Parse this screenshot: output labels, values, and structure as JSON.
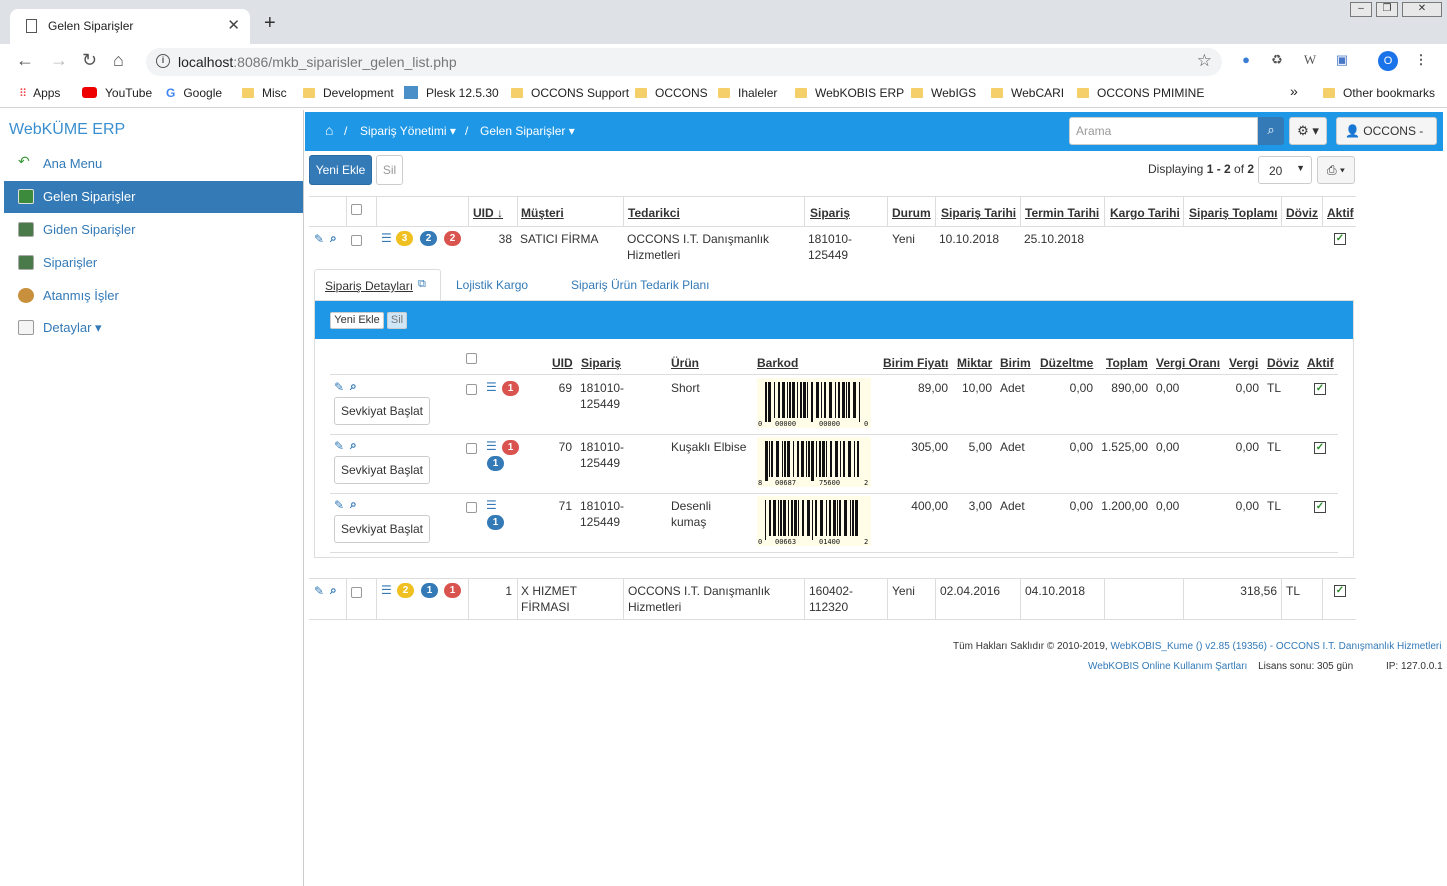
{
  "browser": {
    "tab_title": "Gelen Siparişler",
    "url_host": "localhost",
    "url_rest": ":8086/mkb_siparisler_gelen_list.php",
    "profile_initial": "O",
    "bookmarks": [
      "Apps",
      "YouTube",
      "Google",
      "Misc",
      "Development",
      "Plesk 12.5.30",
      "OCCONS Support",
      "OCCONS",
      "Ihaleler",
      "WebKOBIS ERP",
      "WebIGS",
      "WebCARI",
      "OCCONS PMIMINE"
    ],
    "other_bookmarks": "Other bookmarks",
    "overflow": "»"
  },
  "sidebar": {
    "brand": "WebKÜME ERP",
    "items": [
      {
        "label": "Ana Menu",
        "icon": "back-arrow-icon"
      },
      {
        "label": "Gelen Siparişler",
        "icon": "incoming-orders-icon"
      },
      {
        "label": "Giden Siparişler",
        "icon": "outgoing-orders-icon"
      },
      {
        "label": "Siparişler",
        "icon": "orders-icon"
      },
      {
        "label": "Atanmış İşler",
        "icon": "assigned-jobs-icon"
      },
      {
        "label": "Detaylar",
        "icon": "details-icon"
      }
    ]
  },
  "topbar": {
    "crumb1": "Sipariş Yönetimi",
    "crumb2": "Gelen Siparişler",
    "search_placeholder": "Arama",
    "user": "OCCONS -"
  },
  "list": {
    "new_label": "Yeni Ekle",
    "delete_label": "Sil",
    "display_prefix": "Displaying ",
    "display_range": "1 - 2",
    "display_of": " of ",
    "display_total": "2",
    "page_size": "20",
    "headers": [
      "UID",
      "Müşteri",
      "Tedarikci",
      "Sipariş",
      "Durum",
      "Sipariş Tarihi",
      "Termin Tarihi",
      "Kargo Tarihi",
      "Sipariş Toplamı",
      "Döviz",
      "Aktif"
    ],
    "rows": [
      {
        "badges": [
          "3",
          "2",
          "2"
        ],
        "uid": "38",
        "musteri": "SATICI FİRMA",
        "musteri2": "",
        "tedarikci": "OCCONS I.T. Danışmanlık",
        "tedarikci2": "Hizmetleri",
        "siparis": "181010-",
        "siparis2": "125449",
        "durum": "Yeni",
        "siparis_tarihi": "10.10.2018",
        "termin_tarihi": "25.10.2018",
        "kargo_tarihi": "",
        "toplam": "",
        "doviz": ""
      },
      {
        "badges": [
          "2",
          "1",
          "1"
        ],
        "uid": "1",
        "musteri": "X HIZMET",
        "musteri2": "FİRMASI",
        "tedarikci": "OCCONS I.T. Danışmanlık",
        "tedarikci2": "Hizmetleri",
        "siparis": "160402-",
        "siparis2": "112320",
        "durum": "Yeni",
        "siparis_tarihi": "02.04.2016",
        "termin_tarihi": "04.10.2018",
        "kargo_tarihi": "",
        "toplam": "318,56",
        "doviz": "TL"
      }
    ]
  },
  "detail": {
    "tabs": [
      "Sipariş Detayları",
      "Lojistik Kargo",
      "Sipariş Ürün Tedarik Planı"
    ],
    "new_label": "Yeni Ekle",
    "delete_label": "Sil",
    "headers": [
      "UID",
      "Sipariş",
      "Ürün",
      "Barkod",
      "Birim Fiyatı",
      "Miktar",
      "Birim",
      "Düzeltme",
      "Toplam",
      "Vergi Oranı",
      "Vergi",
      "Döviz",
      "Aktif"
    ],
    "ship_label": "Sevkiyat Başlat",
    "rows": [
      {
        "uid": "69",
        "siparis": "181010-",
        "siparis2": "125449",
        "urun": "Short",
        "urun2": "",
        "fiyat": "89,00",
        "miktar": "10,00",
        "birim": "Adet",
        "duzeltme": "0,00",
        "toplam": "890,00",
        "vergi_orani": "0,00",
        "vergi": "0,00",
        "doviz": "TL",
        "bc_left": "0",
        "bc_mid1": "00000",
        "bc_mid2": "00000",
        "bc_right": "0"
      },
      {
        "uid": "70",
        "siparis": "181010-",
        "siparis2": "125449",
        "urun": "Kuşaklı Elbise",
        "urun2": "",
        "fiyat": "305,00",
        "miktar": "5,00",
        "birim": "Adet",
        "duzeltme": "0,00",
        "toplam": "1.525,00",
        "vergi_orani": "0,00",
        "vergi": "0,00",
        "doviz": "TL",
        "bc_left": "8",
        "bc_mid1": "00687",
        "bc_mid2": "75600",
        "bc_right": "2"
      },
      {
        "uid": "71",
        "siparis": "181010-",
        "siparis2": "125449",
        "urun": "Desenli",
        "urun2": "kumaş",
        "fiyat": "400,00",
        "miktar": "3,00",
        "birim": "Adet",
        "duzeltme": "0,00",
        "toplam": "1.200,00",
        "vergi_orani": "0,00",
        "vergi": "0,00",
        "doviz": "TL",
        "bc_left": "0",
        "bc_mid1": "00663",
        "bc_mid2": "01400",
        "bc_right": "2"
      }
    ]
  },
  "footer": {
    "copyright": "Tüm Hakları Saklıdır © 2010-2019, ",
    "product": "WebKOBIS_Kume () v2.85 (19356)",
    "sep": " - ",
    "company": "OCCONS I.T. Danışmanlık Hizmetleri",
    "terms": "WebKOBIS Online Kullanım Şartları",
    "license": "Lisans sonu: 305 gün",
    "ip": "IP: 127.0.0.1"
  },
  "colors": {
    "accent": "#1d97e6",
    "primary": "#337ab7",
    "badge_yellow": "#f0c020",
    "badge_red": "#d9534f"
  }
}
